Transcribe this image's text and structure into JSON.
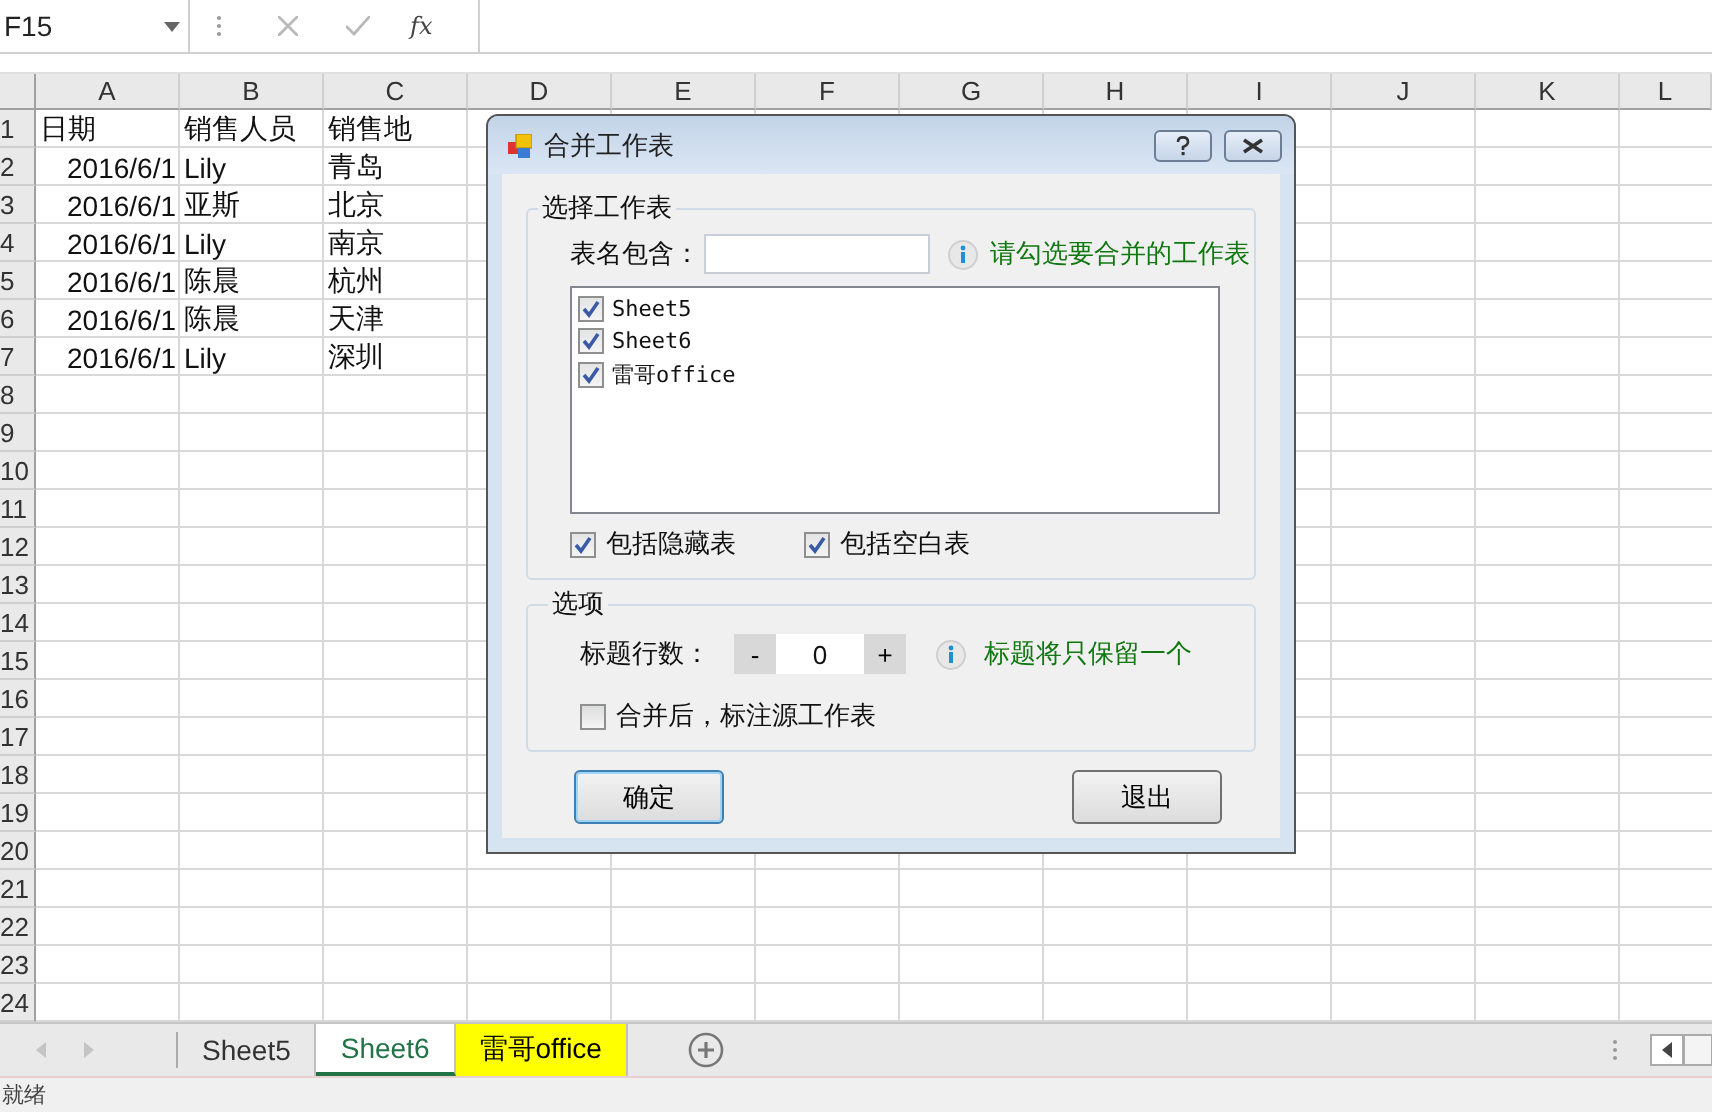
{
  "formula_bar": {
    "name_box": "F15",
    "function_label": "fx"
  },
  "sheet": {
    "columns": [
      "A",
      "B",
      "C",
      "D",
      "E",
      "F",
      "G",
      "H",
      "I",
      "J",
      "K",
      "L"
    ],
    "row_numbers": [
      "1",
      "2",
      "3",
      "4",
      "5",
      "6",
      "7",
      "8",
      "9",
      "10",
      "11",
      "12",
      "13",
      "14",
      "15",
      "16",
      "17",
      "18",
      "19",
      "20",
      "21",
      "22",
      "23",
      "24"
    ],
    "rows": [
      {
        "kind": "header",
        "cells": [
          "日期",
          "销售人员",
          "销售地"
        ]
      },
      {
        "kind": "data",
        "cells": [
          "2016/6/1",
          "Lily",
          "青岛"
        ]
      },
      {
        "kind": "data",
        "cells": [
          "2016/6/1",
          "亚斯",
          "北京"
        ]
      },
      {
        "kind": "data",
        "cells": [
          "2016/6/1",
          "Lily",
          "南京"
        ]
      },
      {
        "kind": "data",
        "cells": [
          "2016/6/1",
          "陈晨",
          "杭州"
        ]
      },
      {
        "kind": "data",
        "cells": [
          "2016/6/1",
          "陈晨",
          "天津"
        ]
      },
      {
        "kind": "data",
        "cells": [
          "2016/6/1",
          "Lily",
          "深圳"
        ]
      }
    ]
  },
  "dialog": {
    "title": "合并工作表",
    "select_group": {
      "legend": "选择工作表",
      "filter_label": "表名包含：",
      "hint": "请勾选要合并的工作表",
      "sheets": [
        {
          "label": "Sheet5",
          "checked": true
        },
        {
          "label": "Sheet6",
          "checked": true
        },
        {
          "label": "雷哥office",
          "checked": true
        }
      ],
      "options": [
        {
          "label": "包括隐藏表",
          "checked": true
        },
        {
          "label": "包括空白表",
          "checked": true
        }
      ]
    },
    "options_group": {
      "legend": "选项",
      "header_rows_label": "标题行数：",
      "decrement": "-",
      "header_rows": "0",
      "increment": "+",
      "hint": "标题将只保留一个",
      "mark_source": {
        "label": "合并后，标注源工作表",
        "checked": false
      }
    },
    "buttons": [
      {
        "label": "确定",
        "focused": true
      },
      {
        "label": "退出",
        "focused": false
      }
    ]
  },
  "sheet_tabs": [
    {
      "label": "Sheet5",
      "selected": false
    },
    {
      "label": "Sheet6",
      "selected": true
    },
    {
      "label": "雷哥office",
      "selected": false,
      "color": "#ffff00"
    }
  ],
  "status_bar": {
    "text": "就绪"
  }
}
